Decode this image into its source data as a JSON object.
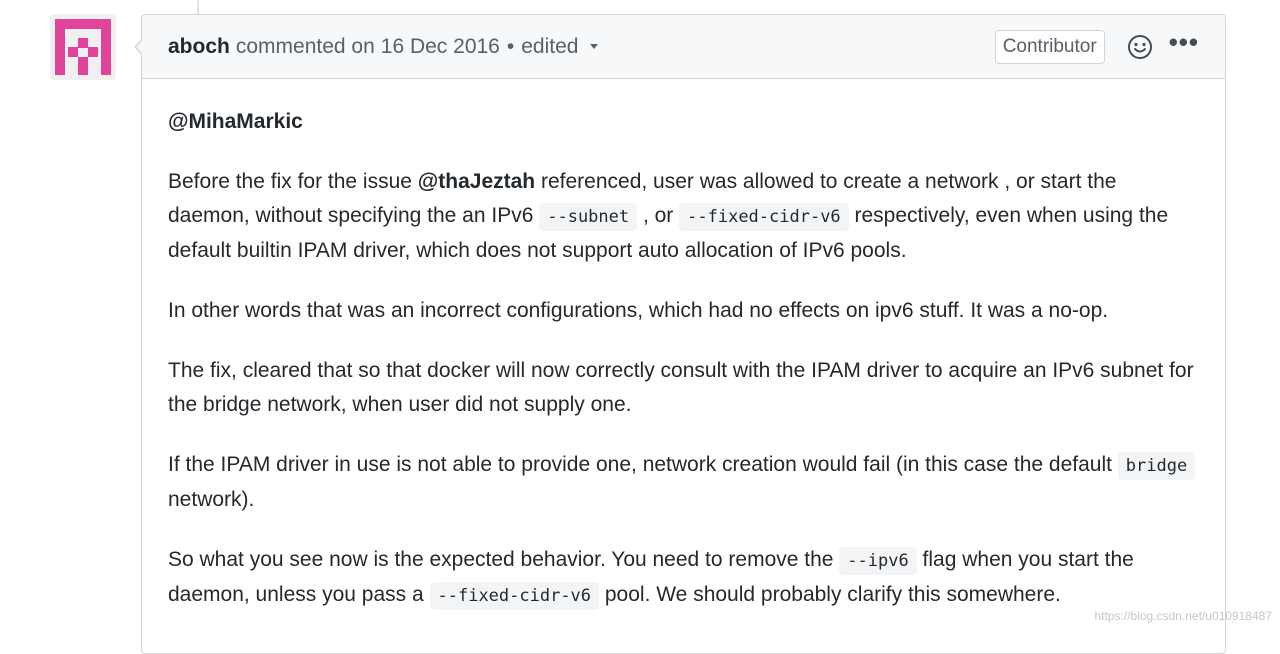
{
  "comment": {
    "author": "aboch",
    "action": "commented on",
    "date": "16 Dec 2016",
    "separator": "•",
    "edited": "edited",
    "badge": "Contributor",
    "more": "•••"
  },
  "body": {
    "p1": {
      "mention": "@MihaMarkic"
    },
    "p2": {
      "t1": "Before the fix for the issue ",
      "mention": "@thaJeztah",
      "t2": " referenced, user was allowed to create a network , or start the daemon, without specifying the an IPv6 ",
      "code1": "--subnet",
      "t3": " , or ",
      "code2": "--fixed-cidr-v6",
      "t4": " respectively, even when using the default builtin IPAM driver, which does not support auto allocation of IPv6 pools."
    },
    "p3": "In other words that was an incorrect configurations, which had no effects on ipv6 stuff. It was a no-op.",
    "p4": "The fix, cleared that so that docker will now correctly consult with the IPAM driver to acquire an IPv6 subnet for the bridge network, when user did not supply one.",
    "p5": {
      "t1": "If the IPAM driver in use is not able to provide one, network creation would fail (in this case the default ",
      "code1": "bridge",
      "t2": " network)."
    },
    "p6": {
      "t1": "So what you see now is the expected behavior. You need to remove the ",
      "code1": "--ipv6",
      "t2": " flag when you start the daemon, unless you pass a ",
      "code2": "--fixed-cidr-v6",
      "t3": " pool. We should probably clarify this somewhere."
    }
  },
  "watermark": "https://blog.csdn.net/u010918487",
  "colors": {
    "avatar": "#e0449a",
    "text": "#24292e",
    "muted": "#586069"
  }
}
